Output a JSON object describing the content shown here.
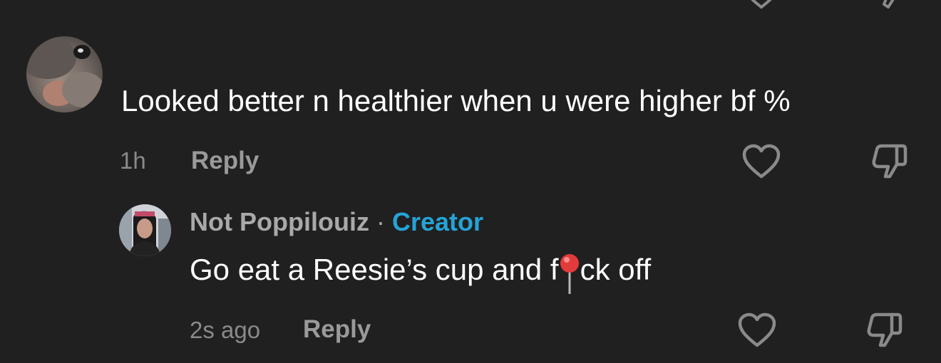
{
  "comment": {
    "text": "Looked better n healthier when u were higher bf %",
    "time": "1h",
    "reply_label": "Reply"
  },
  "reply": {
    "author": "Not Poppilouiz",
    "separator": " · ",
    "badge": "Creator",
    "text_before": "Go eat a Reesie’s cup and f",
    "emoji": "pushpin-icon",
    "text_after": "ck off",
    "time": "2s ago",
    "reply_label": "Reply"
  },
  "colors": {
    "background": "#202020",
    "creator_badge": "#25a3d6",
    "muted_text": "#8a8a8a"
  }
}
